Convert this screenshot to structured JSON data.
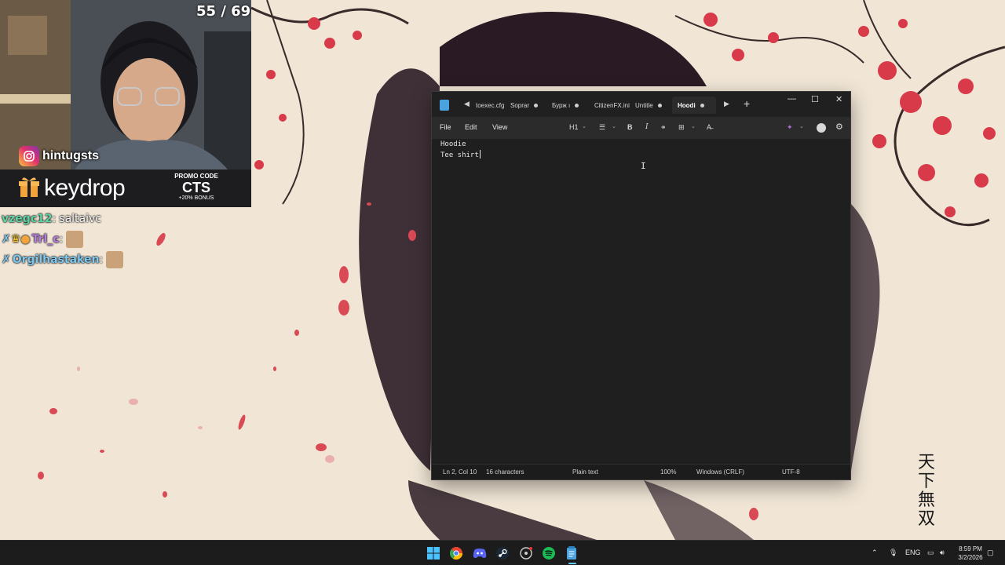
{
  "overlay": {
    "counter": "55 / 69",
    "instagram_handle": "hintugsts",
    "promo": {
      "brand": "keydrop",
      "label": "PROMO CODE",
      "code": "CTS",
      "bonus": "+20% BONUS"
    },
    "chat": [
      {
        "user": "vzegc12",
        "message": "saltaivc",
        "color": "#5fd3a4"
      },
      {
        "user": "Trl_c",
        "message": "",
        "color": "#b77de0"
      },
      {
        "user": "Orgilhastaken",
        "message": "",
        "color": "#7ec8f0"
      }
    ]
  },
  "wallpaper": {
    "kanji": [
      "天",
      "下",
      "無",
      "双"
    ]
  },
  "notepad": {
    "tabs": [
      {
        "label": "toexec.cfg",
        "modified": false
      },
      {
        "label": "Soprar",
        "modified": true
      },
      {
        "label": "Бурж ı",
        "modified": true
      },
      {
        "label": "CitizenFX.ini",
        "modified": false
      },
      {
        "label": "Untitle",
        "modified": true
      },
      {
        "label": "Hoodi",
        "modified": true,
        "active": true
      }
    ],
    "new_tab_symbol": "+",
    "window_controls": {
      "minimize": "—",
      "maximize": "☐",
      "close": "✕"
    },
    "menu": {
      "file": "File",
      "edit": "Edit",
      "view": "View"
    },
    "toolbar": {
      "heading": "H1",
      "bold": "B",
      "italic": "I"
    },
    "content": [
      "Hoodie",
      "Tee shirt"
    ],
    "status": {
      "position": "Ln 2, Col 10",
      "characters": "16 characters",
      "format": "Plain text",
      "zoom": "100%",
      "line_ending": "Windows (CRLF)",
      "encoding": "UTF-8"
    }
  },
  "taskbar": {
    "language": "ENG",
    "time": "8:59 PM",
    "date": "3/2/2026"
  }
}
